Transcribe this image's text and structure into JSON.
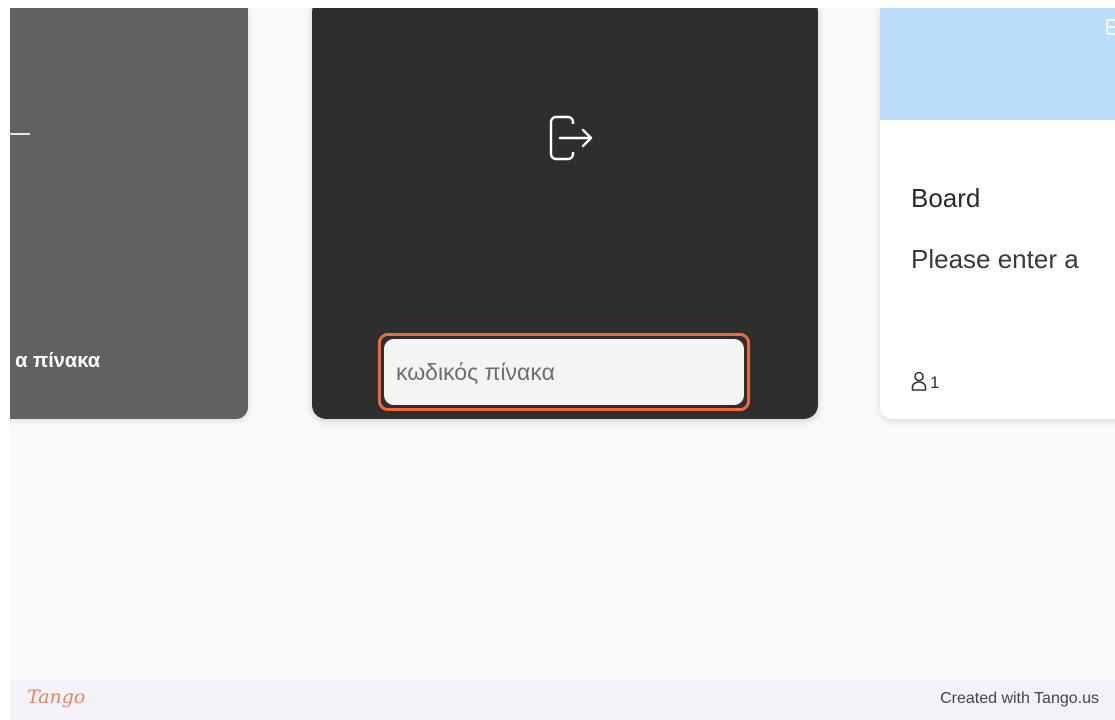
{
  "create_card": {
    "label": "α πίνακα"
  },
  "join_card": {
    "icon": "door-exit-icon",
    "code_input": {
      "value": "",
      "placeholder": "κωδικός πίνακα"
    },
    "highlight_color": "#f0693a"
  },
  "board_card": {
    "title": "Board",
    "description": "Please enter a",
    "cover_color": "#bcdcfb",
    "members_icon": "person-icon",
    "members_count": "1"
  },
  "footer": {
    "logo": "Tango",
    "credit": "Created with Tango.us"
  }
}
